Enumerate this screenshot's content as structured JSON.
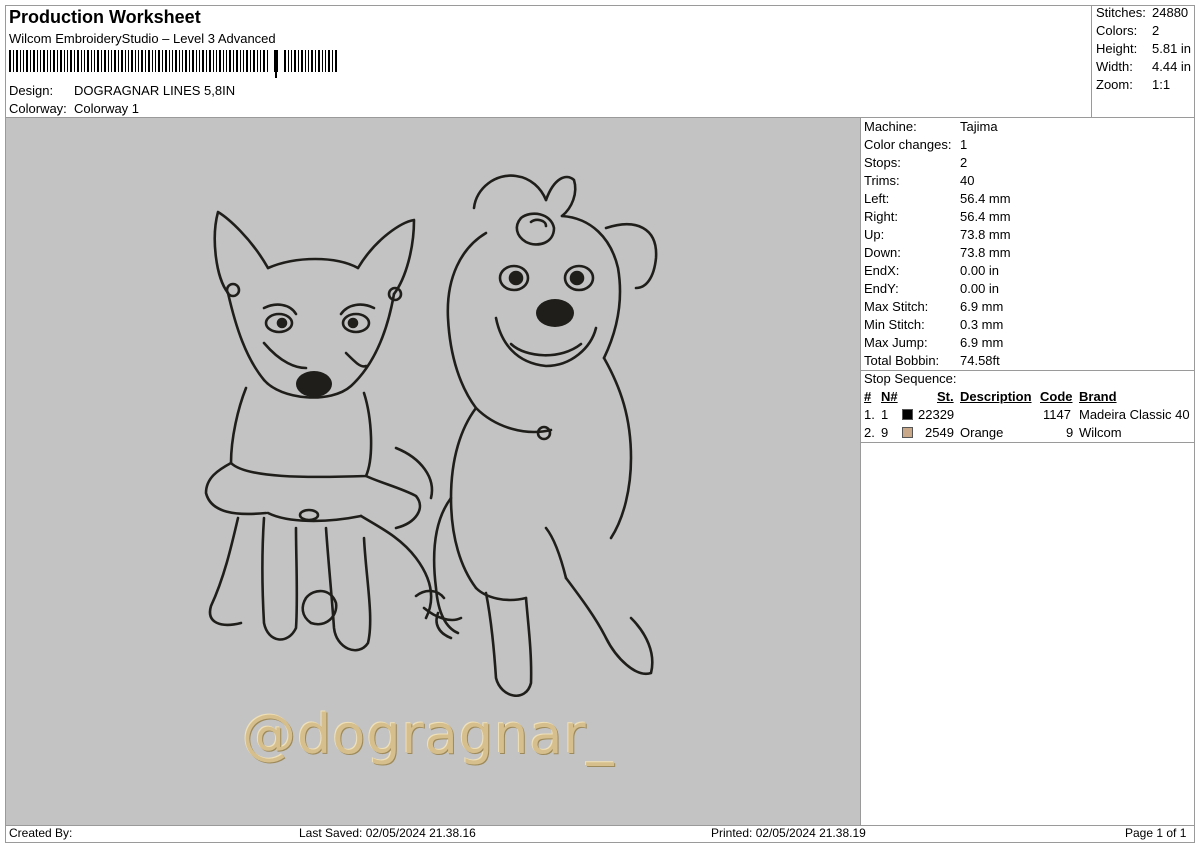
{
  "header": {
    "title": "Production Worksheet",
    "subtitle": "Wilcom EmbroideryStudio – Level 3 Advanced",
    "design_label": "Design:",
    "design_value": "DOGRAGNAR LINES 5,8IN",
    "colorway_label": "Colorway:",
    "colorway_value": "Colorway 1"
  },
  "summary": [
    {
      "label": "Stitches:",
      "value": "24880"
    },
    {
      "label": "Colors:",
      "value": "2"
    },
    {
      "label": "Height:",
      "value": "5.81 in"
    },
    {
      "label": "Width:",
      "value": "4.44 in"
    },
    {
      "label": "Zoom:",
      "value": "1:1"
    }
  ],
  "machine_info": [
    {
      "label": "Machine:",
      "value": "Tajima"
    },
    {
      "label": "Color changes:",
      "value": "1"
    },
    {
      "label": "Stops:",
      "value": "2"
    },
    {
      "label": "Trims:",
      "value": "40"
    },
    {
      "label": "Left:",
      "value": "56.4 mm"
    },
    {
      "label": "Right:",
      "value": "56.4 mm"
    },
    {
      "label": "Up:",
      "value": "73.8 mm"
    },
    {
      "label": "Down:",
      "value": "73.8 mm"
    },
    {
      "label": "EndX:",
      "value": "0.00 in"
    },
    {
      "label": "EndY:",
      "value": "0.00 in"
    },
    {
      "label": "Max Stitch:",
      "value": "6.9 mm"
    },
    {
      "label": "Min Stitch:",
      "value": "0.3 mm"
    },
    {
      "label": "Max Jump:",
      "value": "6.9 mm"
    },
    {
      "label": "Total Bobbin:",
      "value": "74.58ft"
    }
  ],
  "stop_sequence": {
    "label": "Stop Sequence:",
    "headers": {
      "stop": "#",
      "n": "N#",
      "st": "St.",
      "description": "Description",
      "code": "Code",
      "brand": "Brand"
    },
    "rows": [
      {
        "stop": "1.",
        "n": "1",
        "color": "#000000",
        "st": "22329",
        "description": "",
        "code": "1147",
        "brand": "Madeira Classic 40"
      },
      {
        "stop": "2.",
        "n": "9",
        "color": "#c8a888",
        "st": "2549",
        "description": "Orange",
        "code": "9",
        "brand": "Wilcom"
      }
    ]
  },
  "design_text": "@dogragnar_",
  "colors": {
    "canvas": "#c3c3c3",
    "line_thread": "#1f1e1b",
    "text_thread": "#d6bf8c"
  },
  "footer": {
    "created_by": "Created By:",
    "last_saved": "Last Saved: 02/05/2024 21.38.16",
    "printed": "Printed: 02/05/2024 21.38.19",
    "page": "Page 1 of 1"
  }
}
